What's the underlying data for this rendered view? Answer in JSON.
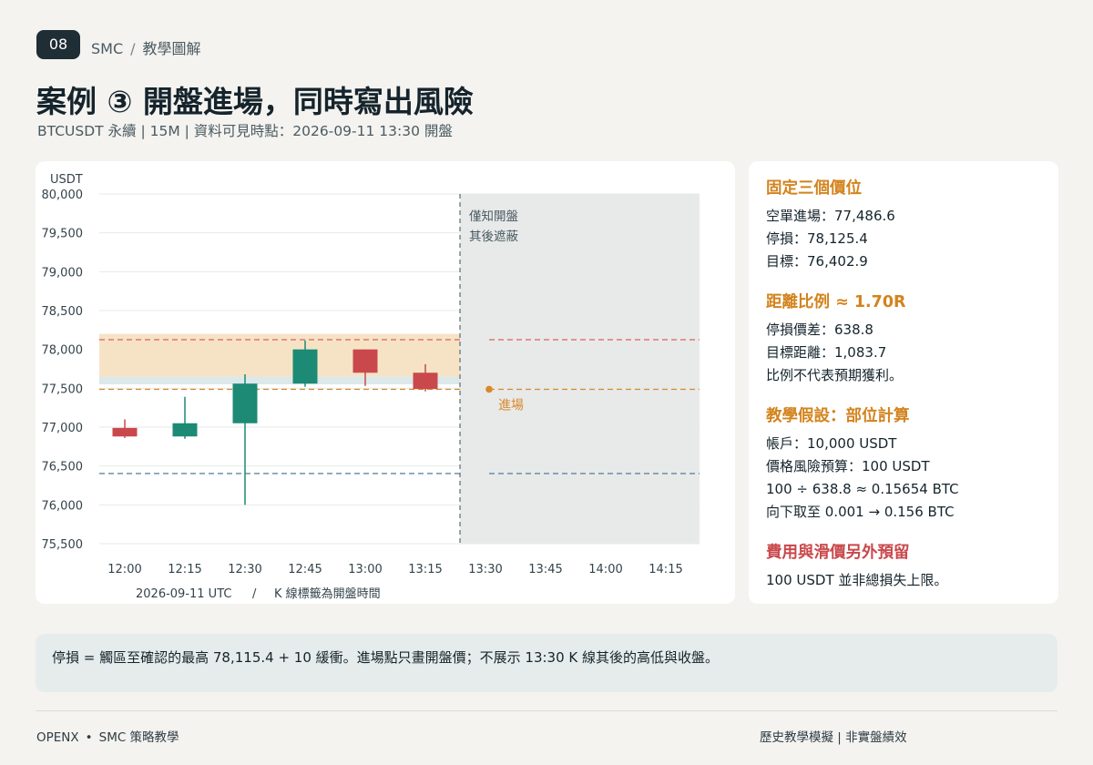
{
  "header": {
    "badge": "08",
    "crumb_section": "SMC",
    "crumb_sep": "/",
    "crumb_page": "教學圖解",
    "title": "案例 ③  開盤進場，同時寫出風險",
    "subtitle": "BTCUSDT 永續 | 15M | 資料可見時點：2026-09-11 13:30 開盤"
  },
  "chart_data": {
    "type": "candlestick",
    "ylabel": "USDT",
    "ylim": [
      75500,
      80000
    ],
    "y_ticks": [
      "80,000",
      "79,500",
      "79,000",
      "78,500",
      "78,000",
      "77,500",
      "77,000",
      "76,500",
      "76,000",
      "75,500"
    ],
    "y_tick_values": [
      80000,
      79500,
      79000,
      78500,
      78000,
      77500,
      77000,
      76500,
      76000,
      75500
    ],
    "x_ticks": [
      "12:00",
      "12:15",
      "12:30",
      "12:45",
      "13:00",
      "13:15",
      "13:30",
      "13:45",
      "14:00",
      "14:15"
    ],
    "candles": [
      {
        "time": "12:00",
        "open": 76990,
        "high": 77100,
        "low": 76860,
        "close": 76880
      },
      {
        "time": "12:15",
        "open": 76880,
        "high": 77390,
        "low": 76850,
        "close": 77050
      },
      {
        "time": "12:30",
        "open": 77050,
        "high": 77680,
        "low": 76000,
        "close": 77560
      },
      {
        "time": "12:45",
        "open": 77560,
        "high": 78115.4,
        "low": 77520,
        "close": 78000
      },
      {
        "time": "13:00",
        "open": 78000,
        "high": 78000,
        "low": 77530,
        "close": 77700
      },
      {
        "time": "13:15",
        "open": 77700,
        "high": 77810,
        "low": 77460,
        "close": 77490
      }
    ],
    "zone_supply": [
      77650,
      78200
    ],
    "zone_support": [
      77550,
      77650
    ],
    "stop_level": 78125.4,
    "entry_level": 77486.6,
    "target_level": 76402.9,
    "entry_time": "13:30",
    "masked_from_time": "13:30",
    "mask_label_1": "僅知開盤",
    "mask_label_2": "其後遮蔽",
    "entry_label": "進場",
    "x_footer_date": "2026-09-11 UTC",
    "x_footer_sep": "/",
    "x_footer_note": "K 線標籤為開盤時間",
    "colors": {
      "up": "#1c8a74",
      "down": "#c9484b",
      "stop": "#d9605f",
      "entry": "#d8892a",
      "target": "#5f86a5",
      "supply_zone": "#f6e3c6",
      "support_zone": "#dce8ea",
      "mask": "#e8eae9",
      "grid": "#e6e9ea"
    }
  },
  "side": {
    "s1_title": "固定三個價位",
    "s1_l1": "空單進場：77,486.6",
    "s1_l2": "停損：78,125.4",
    "s1_l3": "目標：76,402.9",
    "s2_title": "距離比例 ≈ 1.70R",
    "s2_l1": "停損價差：638.8",
    "s2_l2": "目標距離：1,083.7",
    "s2_l3": "比例不代表預期獲利。",
    "s3_title": "教學假設：部位計算",
    "s3_l1": "帳戶：10,000 USDT",
    "s3_l2": "價格風險預算：100 USDT",
    "s3_l3": "100 ÷ 638.8 ≈ 0.15654 BTC",
    "s3_l4": "向下取至 0.001 → 0.156 BTC",
    "s4_title": "費用與滑價另外預留",
    "s4_l1": "100 USDT 並非總損失上限。"
  },
  "note": {
    "text": "停損 = 觸區至確認的最高 78,115.4 + 10 緩衝。進場點只畫開盤價；不展示 13:30 K 線其後的高低與收盤。"
  },
  "footer": {
    "brand": "OPENX",
    "dot": "•",
    "tagline": "SMC 策略教學",
    "disclaimer": "歷史教學模擬 | 非實盤績效"
  }
}
